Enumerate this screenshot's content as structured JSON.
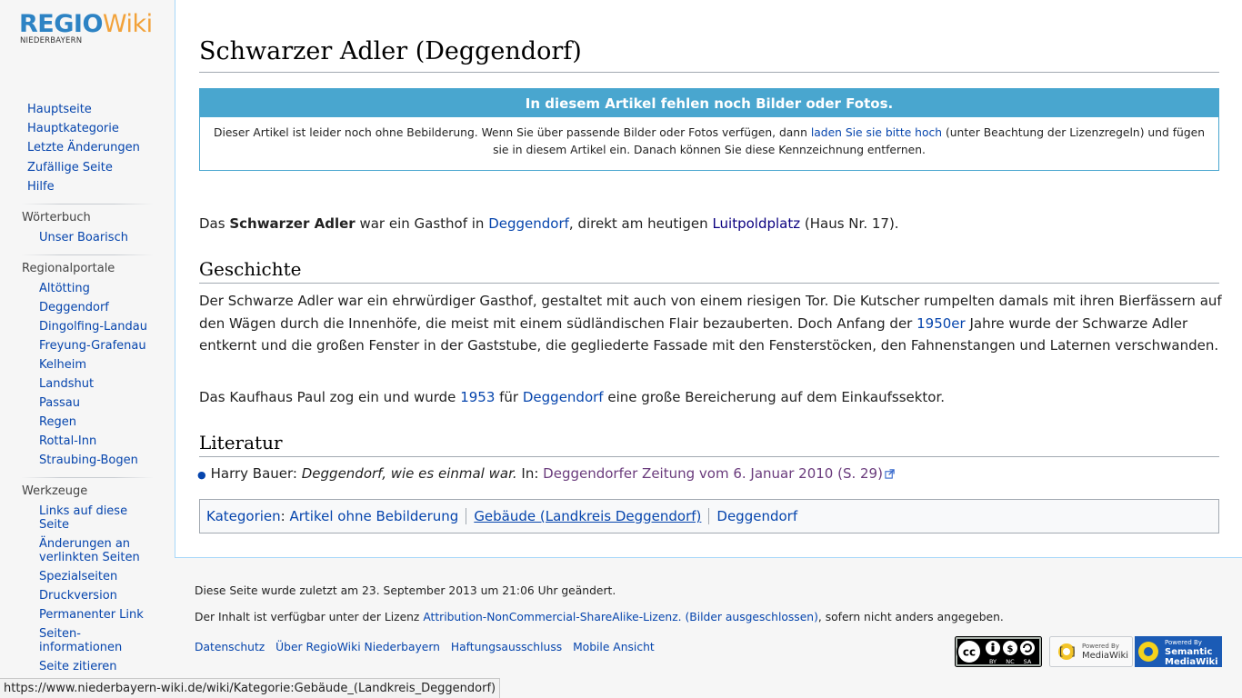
{
  "logo": {
    "regio": "REGIO",
    "wiki": "Wiki",
    "sub": "NIEDERBAYERN"
  },
  "sidebar": {
    "main": [
      "Hauptseite",
      "Hauptkategorie",
      "Letzte Änderungen",
      "Zufällige Seite",
      "Hilfe"
    ],
    "woerterbuch": {
      "heading": "Wörterbuch",
      "items": [
        "Unser Boarisch"
      ]
    },
    "regionalportale": {
      "heading": "Regionalportale",
      "items": [
        "Altötting",
        "Deggendorf",
        "Dingolfing-Landau",
        "Freyung-Grafenau",
        "Kelheim",
        "Landshut",
        "Passau",
        "Regen",
        "Rottal-Inn",
        "Straubing-Bogen"
      ]
    },
    "werkzeuge": {
      "heading": "Werkzeuge",
      "items": [
        "Links auf diese Seite",
        "Änderungen an verlinkten Seiten",
        "Spezialseiten",
        "Druckversion",
        "Permanenter Link",
        "Seiten­informationen",
        "Seite zitieren"
      ]
    }
  },
  "article": {
    "title": "Schwarzer Adler (Deggendorf)",
    "notice": {
      "heading": "In diesem Artikel fehlen noch Bilder oder Fotos.",
      "text1": "Dieser Artikel ist leider noch ohne Bebilderung. Wenn Sie über passende Bilder oder Fotos verfügen, dann ",
      "link": "laden Sie sie bitte hoch",
      "text2": " (unter Beachtung der Lizenzregeln) und fügen sie in diesem Artikel ein. Danach können Sie diese Kennzeichnung entfernen."
    },
    "intro": {
      "t1": "Das ",
      "bold": "Schwarzer Adler",
      "t2": " war ein Gasthof in ",
      "link1": "Deggendorf",
      "t3": ", direkt am heutigen ",
      "link2": "Luitpoldplatz",
      "t4": " (Haus Nr. 17)."
    },
    "h_geschichte": "Geschichte",
    "geschichte_p1": {
      "t1": "Der Schwarze Adler war ein ehrwürdiger Gasthof, gestaltet mit auch von einem riesigen Tor. Die Kutscher rumpelten damals mit ihren Bierfässern auf den Wägen durch die Innenhöfe, die meist mit einem südländischen Flair bezauberten. Doch Anfang der ",
      "link": "1950er",
      "t2": " Jahre wurde der Schwarze Adler entkernt und die großen Fenster in der Gaststube, die gegliederte Fassade mit den Fensterstöcken, den Fahnenstangen und Laternen verschwanden."
    },
    "geschichte_p2": {
      "t1": "Das Kaufhaus Paul zog ein und wurde ",
      "link1": "1953",
      "t2": " für ",
      "link2": "Deggendorf",
      "t3": " eine große Bereicherung auf dem Einkaufssektor."
    },
    "h_literatur": "Literatur",
    "literatur": {
      "author": "Harry Bauer: ",
      "work": "Deggendorf, wie es einmal war.",
      "in": " In: ",
      "link": "Deggendorfer Zeitung vom 6. Januar 2010 (S. 29)"
    },
    "categories": {
      "label": "Kategorien",
      "colon": ":",
      "items": [
        "Artikel ohne Bebilderung",
        "Gebäude (Landkreis Deggendorf)",
        "Deggendorf"
      ]
    }
  },
  "footer": {
    "lastmod": "Diese Seite wurde zuletzt am 23. September 2013 um 21:06 Uhr geändert.",
    "license_pre": "Der Inhalt ist verfügbar unter der Lizenz ",
    "license_link": "Attribution-NonCommercial-ShareAlike-Lizenz. (Bilder ausgeschlossen)",
    "license_post": ", sofern nicht anders angegeben.",
    "links": [
      "Datenschutz",
      "Über RegioWiki Niederbayern",
      "Haftungsausschluss",
      "Mobile Ansicht"
    ],
    "badges": {
      "cc": {
        "cc": "cc",
        "by": "BY",
        "nc": "NC",
        "sa": "SA"
      },
      "mw": {
        "powered": "Powered By",
        "name": "MediaWiki"
      },
      "smw": {
        "powered": "Powered By",
        "name1": "Semantic",
        "name2": "MediaWiki"
      }
    }
  },
  "statusbar": {
    "url": "https://www.niederbayern-wiki.de/wiki/Kategorie:Gebäude_(Landkreis_Deggendorf)"
  },
  "colors": {
    "link": "#0645ad",
    "notice": "#49a6cf",
    "logo_blue": "#2d83c4",
    "logo_orange": "#f2a23a"
  }
}
